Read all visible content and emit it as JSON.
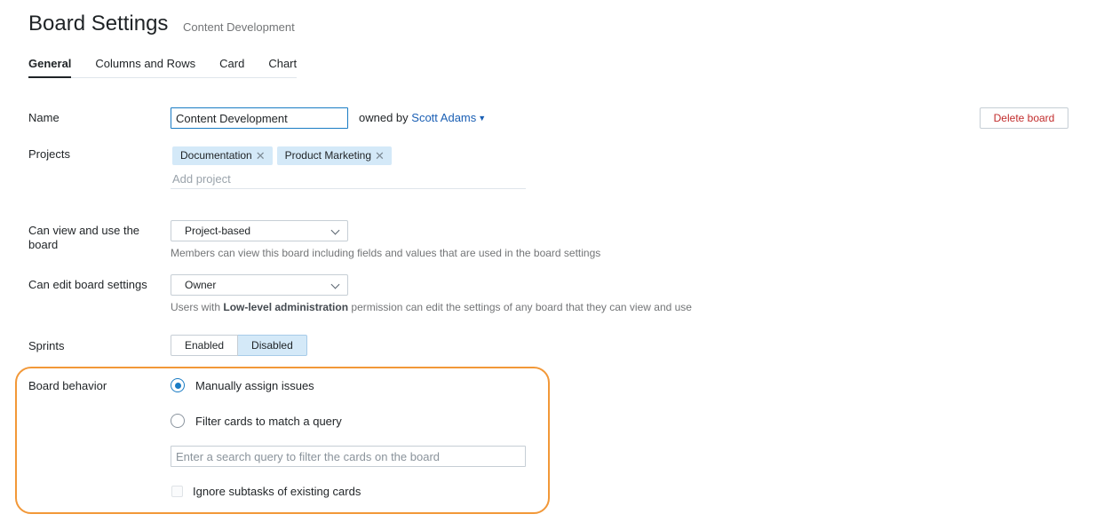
{
  "header": {
    "title": "Board Settings",
    "subtitle": "Content Development"
  },
  "tabs": [
    {
      "label": "General",
      "active": true
    },
    {
      "label": "Columns and Rows",
      "active": false
    },
    {
      "label": "Card",
      "active": false
    },
    {
      "label": "Chart",
      "active": false
    }
  ],
  "name_field": {
    "label": "Name",
    "value": "Content Development",
    "owned_by_prefix": "owned by",
    "owner": "Scott Adams"
  },
  "delete_button": {
    "label": "Delete board"
  },
  "projects": {
    "label": "Projects",
    "items": [
      "Documentation",
      "Product Marketing"
    ],
    "add_placeholder": "Add project"
  },
  "view_use": {
    "label": "Can view and use the board",
    "selected": "Project-based",
    "hint": "Members can view this board including fields and values that are used in the board settings"
  },
  "edit_settings": {
    "label": "Can edit board settings",
    "selected": "Owner",
    "hint_prefix": "Users with",
    "hint_bold": "Low-level administration",
    "hint_suffix": "permission can edit the settings of any board that they can view and use"
  },
  "sprints": {
    "label": "Sprints",
    "options": [
      "Enabled",
      "Disabled"
    ],
    "selected": "Disabled"
  },
  "board_behavior": {
    "label": "Board behavior",
    "options": [
      {
        "label": "Manually assign issues",
        "checked": true
      },
      {
        "label": "Filter cards to match a query",
        "checked": false
      }
    ],
    "query_placeholder": "Enter a search query to filter the cards on the board",
    "subtasks_label": "Ignore subtasks of existing cards",
    "subtasks_checked": false
  },
  "colors": {
    "accent": "#1a7cc4",
    "highlight_border": "#f29838",
    "danger": "#c22d2d",
    "chip_bg": "#d4e9f8"
  }
}
